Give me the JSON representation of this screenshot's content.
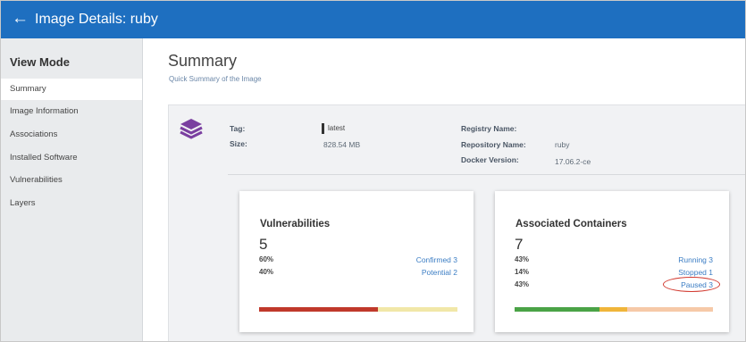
{
  "header": {
    "back_glyph": "←",
    "title": "Image Details: ruby"
  },
  "sidebar": {
    "mode_title": "View Mode",
    "items": [
      {
        "label": "Summary",
        "active": true
      },
      {
        "label": "Image Information",
        "active": false
      },
      {
        "label": "Associations",
        "active": false
      },
      {
        "label": "Installed Software",
        "active": false
      },
      {
        "label": "Vulnerabilities",
        "active": false
      },
      {
        "label": "Layers",
        "active": false
      }
    ]
  },
  "main": {
    "title": "Summary",
    "subtitle": "Quick Summary of the Image"
  },
  "details": {
    "icon": "layers-icon",
    "tag_label": "Tag:",
    "tag_value": "latest",
    "size_label": "Size:",
    "size_value": "828.54 MB",
    "registry_label": "Registry Name:",
    "registry_value": "",
    "repository_label": "Repository Name:",
    "repository_value": "ruby",
    "docker_label": "Docker Version:",
    "docker_value": "17.06.2-ce"
  },
  "vulnerabilities": {
    "title": "Vulnerabilities",
    "count": "5",
    "rows": [
      {
        "pct": "60%",
        "label": "Confirmed 3"
      },
      {
        "pct": "40%",
        "label": "Potential 2"
      }
    ],
    "bar": [
      {
        "fraction": 0.6,
        "color": "#c0392b"
      },
      {
        "fraction": 0.4,
        "color": "#f1e7a8"
      }
    ]
  },
  "containers": {
    "title": "Associated Containers",
    "count": "7",
    "rows": [
      {
        "pct": "43%",
        "label": "Running 3"
      },
      {
        "pct": "14%",
        "label": "Stopped 1"
      },
      {
        "pct": "43%",
        "label": "Paused 3"
      }
    ],
    "bar": [
      {
        "fraction": 0.43,
        "color": "#4aa346"
      },
      {
        "fraction": 0.14,
        "color": "#f0b53a"
      },
      {
        "fraction": 0.43,
        "color": "#f6c9a8"
      }
    ],
    "highlight": "Paused 3"
  },
  "colors": {
    "topbar": "#1e6fc0",
    "link": "#3b7dc4",
    "highlight_ring": "#d23a30"
  }
}
